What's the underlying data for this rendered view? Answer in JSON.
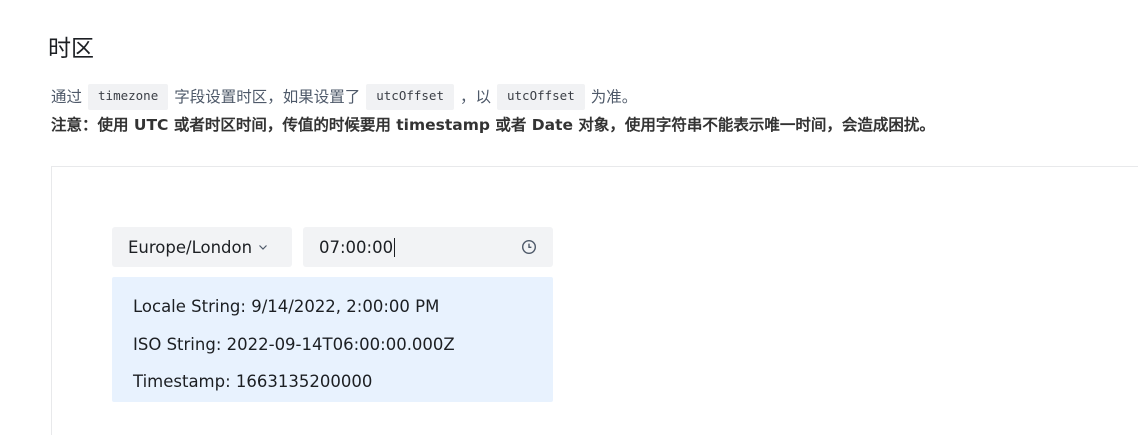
{
  "section": {
    "title": "时区"
  },
  "description": {
    "part1": "通过",
    "code1": "timezone",
    "part2": "字段设置时区，如果设置了",
    "code2": "utcOffset",
    "part3": "，以",
    "code3": "utcOffset",
    "part4": "为准。"
  },
  "note": {
    "text": "注意：使用 UTC 或者时区时间，传值的时候要用 timestamp 或者 Date 对象，使用字符串不能表示唯一时间，会造成困扰。"
  },
  "demo": {
    "timezone_select": {
      "value": "Europe/London",
      "icon": "chevron-down-icon"
    },
    "time_input": {
      "value": "07:00:00",
      "icon": "clock-icon"
    },
    "result": {
      "locale_string": "Locale String: 9/14/2022, 2:00:00 PM",
      "iso_string": "ISO String: 2022-09-14T06:00:00.000Z",
      "timestamp": "Timestamp: 1663135200000"
    }
  },
  "colors": {
    "input_bg": "#f2f3f5",
    "result_bg": "#e8f2fe",
    "code_bg": "#f1f2f4",
    "text_primary": "#1c1f23",
    "text_secondary": "#4e5969"
  }
}
